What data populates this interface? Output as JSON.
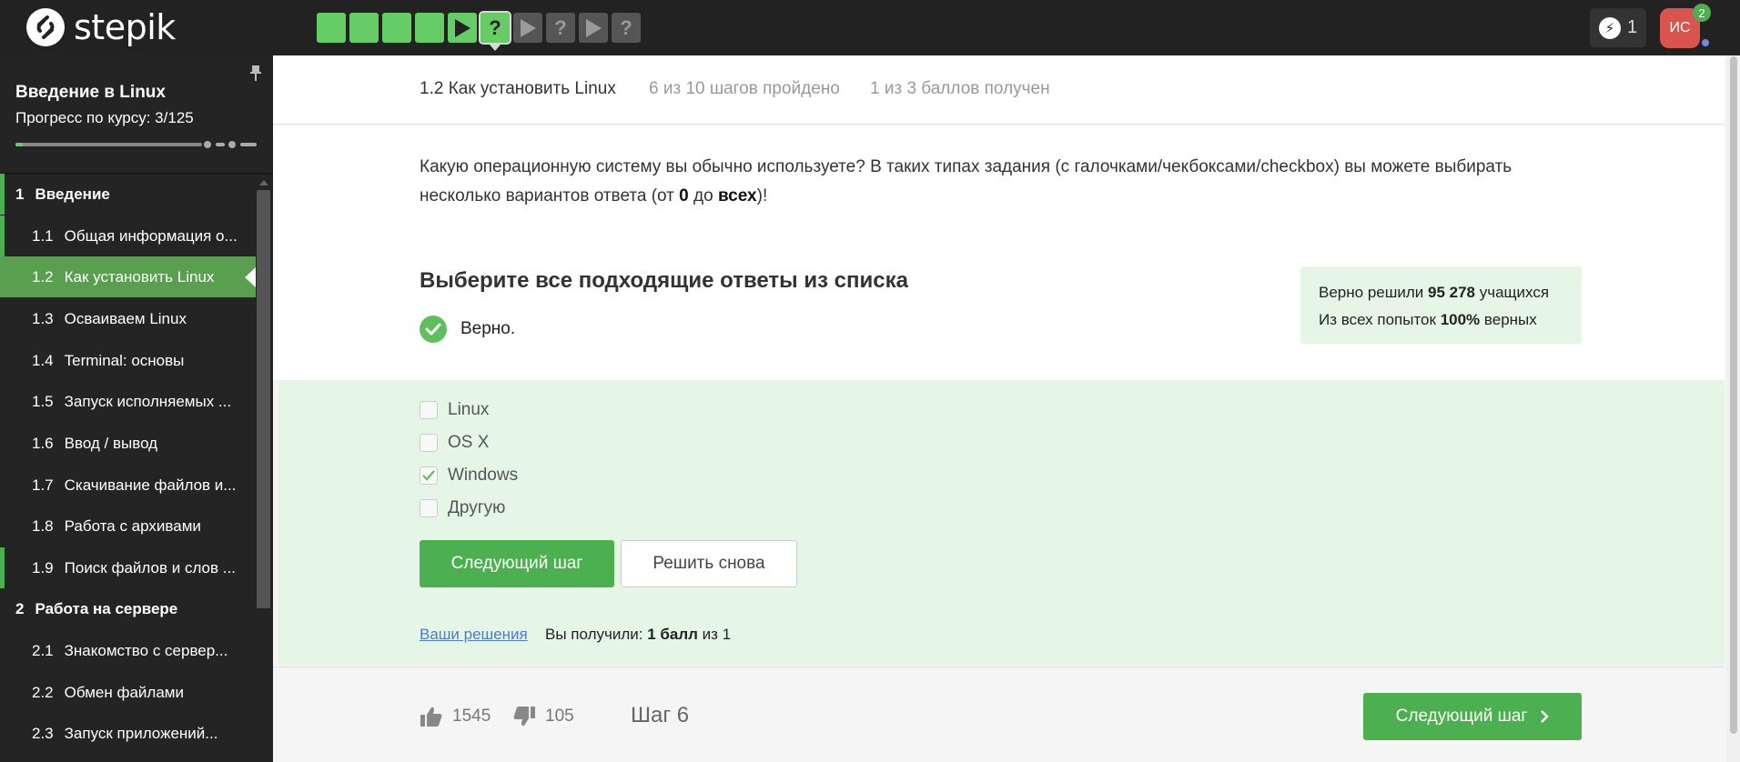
{
  "topbar": {
    "logo_text": "stepik",
    "steps": [
      {
        "state": "done",
        "type": "square"
      },
      {
        "state": "done",
        "type": "square"
      },
      {
        "state": "done",
        "type": "square"
      },
      {
        "state": "done",
        "type": "square"
      },
      {
        "state": "done",
        "type": "play"
      },
      {
        "state": "active",
        "type": "question",
        "glyph": "?"
      },
      {
        "state": "todo",
        "type": "play"
      },
      {
        "state": "todo",
        "type": "question",
        "glyph": "?"
      },
      {
        "state": "todo",
        "type": "play"
      },
      {
        "state": "todo",
        "type": "question",
        "glyph": "?"
      }
    ],
    "energy_count": "1",
    "avatar_initials": "ИС",
    "notification_count": "2"
  },
  "sidebar": {
    "course_title": "Введение в Linux",
    "progress_label": "Прогресс по курсу:  3/125",
    "progress_fraction": 0.024,
    "sections": [
      {
        "num": "1",
        "title": "Введение"
      },
      {
        "num": "2",
        "title": "Работа на сервере"
      }
    ],
    "lessons": [
      {
        "num": "1.1",
        "title": "Общая информация о..."
      },
      {
        "num": "1.2",
        "title": "Как установить Linux"
      },
      {
        "num": "1.3",
        "title": "Осваиваем Linux"
      },
      {
        "num": "1.4",
        "title": "Terminal: основы"
      },
      {
        "num": "1.5",
        "title": "Запуск исполняемых ..."
      },
      {
        "num": "1.6",
        "title": "Ввод / вывод"
      },
      {
        "num": "1.7",
        "title": "Скачивание файлов и..."
      },
      {
        "num": "1.8",
        "title": "Работа с архивами"
      },
      {
        "num": "1.9",
        "title": "Поиск файлов и слов ..."
      },
      {
        "num": "2.1",
        "title": "Знакомство с сервер..."
      },
      {
        "num": "2.2",
        "title": "Обмен файлами"
      },
      {
        "num": "2.3",
        "title": "Запуск приложений..."
      }
    ]
  },
  "header": {
    "lesson_title": "1.2 Как установить Linux",
    "steps_done": "6 из 10 шагов пройдено",
    "score": "1 из 3 баллов  получен"
  },
  "question": {
    "text_before": "Какую операционную систему вы обычно используете? В таких типах задания (с галочками/чекбоксами/checkbox) вы можете выбирать несколько вариантов ответа (от ",
    "bold_min": "0",
    "text_middle": " до ",
    "bold_max": "всех",
    "text_after": ")!",
    "choose_title": "Выберите все подходящие ответы из списка",
    "verdict": "Верно."
  },
  "stats": {
    "line1_prefix": "Верно решили ",
    "line1_value": "95 278",
    "line1_suffix": " учащихся",
    "line2_prefix": "Из всех попыток ",
    "line2_value": "100%",
    "line2_suffix": " верных"
  },
  "options": [
    {
      "label": "Linux",
      "checked": false
    },
    {
      "label": "OS X",
      "checked": false
    },
    {
      "label": "Windows",
      "checked": true
    },
    {
      "label": "Другую",
      "checked": false
    }
  ],
  "actions": {
    "next_step": "Следующий шаг",
    "retry": "Решить снова",
    "your_solutions": "Ваши решения",
    "received_prefix": "Вы получили: ",
    "received_value": "1 балл",
    "received_suffix": " из 1"
  },
  "footer": {
    "likes": "1545",
    "dislikes": "105",
    "step_label": "Шаг 6",
    "next_step": "Следующий шаг"
  },
  "colors": {
    "accent_green": "#4caf50",
    "step_done": "#66cc66",
    "answer_bg": "#e6f6e6",
    "topbar_bg": "#222222"
  }
}
